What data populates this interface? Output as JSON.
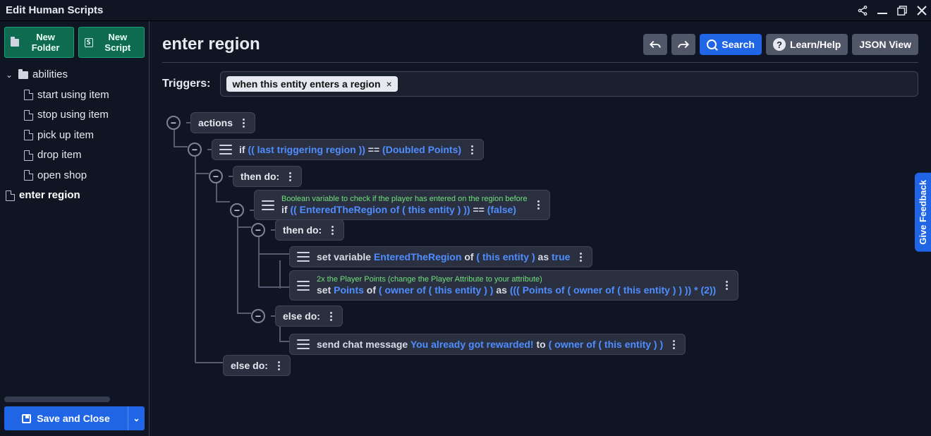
{
  "titlebar": {
    "title": "Edit Human Scripts"
  },
  "sidebar": {
    "new_folder": "New Folder",
    "new_script": "New Script",
    "tree": {
      "folder": "abilities",
      "items": [
        "start using item",
        "stop using item",
        "pick up item",
        "drop item",
        "open shop"
      ],
      "root_item": "enter region"
    },
    "save": "Save and Close"
  },
  "editor": {
    "title": "enter region",
    "tools": {
      "search": "Search",
      "learn": "Learn/Help",
      "json": "JSON View"
    },
    "triggers_label": "Triggers:",
    "trigger_chip": "when this entity enters a region",
    "nodes": {
      "actions": "actions",
      "if1": {
        "kw": "if",
        "expr1": "(( last triggering region ))",
        "op": "==",
        "expr2": "(Doubled Points)"
      },
      "then": "then do:",
      "comment1": "Boolean variable to check if the player has entered on the region before",
      "if2": {
        "kw": "if",
        "expr1": "(( EnteredTheRegion of ( this entity ) ))",
        "op": "==",
        "expr2": "(false)"
      },
      "then2": "then do:",
      "setvar": {
        "pre": "set variable",
        "var": "EnteredTheRegion",
        "mid": "of",
        "ent": "( this entity )",
        "as": "as",
        "val": "true"
      },
      "comment2": "2x the Player Points (change the Player Attribute to your attribute)",
      "setpts": {
        "pre": "set",
        "var": "Points",
        "mid": "of",
        "ent": "( owner of ( this entity ) )",
        "as": "as",
        "val": "((( Points of ( owner of ( this entity ) ) )) * (2))"
      },
      "else2": "else do:",
      "chat": {
        "pre": "send chat message",
        "msg": "You already got rewarded!",
        "mid": "to",
        "tgt": "( owner of ( this entity ) )"
      },
      "else1": "else do:"
    }
  },
  "feedback": "Give Feedback"
}
